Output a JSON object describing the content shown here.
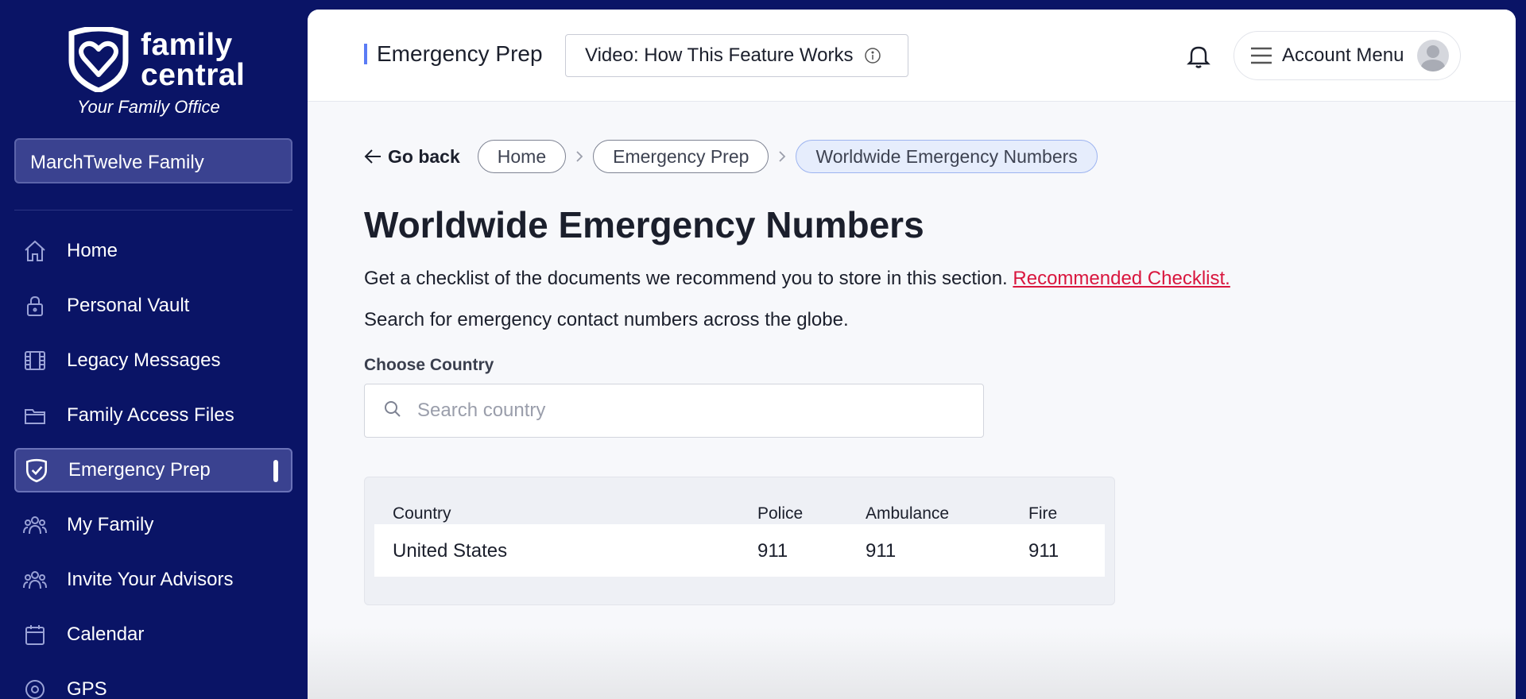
{
  "brand": {
    "name_line1": "family",
    "name_line2": "central",
    "tagline": "Your Family Office"
  },
  "family_selector": "MarchTwelve Family",
  "sidebar": {
    "items": [
      {
        "label": "Home",
        "icon": "home-icon"
      },
      {
        "label": "Personal Vault",
        "icon": "lock-icon"
      },
      {
        "label": "Legacy Messages",
        "icon": "film-icon"
      },
      {
        "label": "Family Access Files",
        "icon": "folder-icon"
      },
      {
        "label": "Emergency Prep",
        "icon": "shield-check-icon",
        "active": true
      },
      {
        "label": "My Family",
        "icon": "people-icon"
      },
      {
        "label": "Invite Your Advisors",
        "icon": "people-icon"
      },
      {
        "label": "Calendar",
        "icon": "calendar-icon"
      },
      {
        "label": "GPS",
        "icon": "location-icon"
      }
    ]
  },
  "header": {
    "title": "Emergency Prep",
    "video_button": "Video: How This Feature Works",
    "account_menu": "Account Menu"
  },
  "breadcrumb": {
    "back": "Go back",
    "items": [
      "Home",
      "Emergency Prep",
      "Worldwide Emergency Numbers"
    ]
  },
  "page": {
    "title": "Worldwide Emergency Numbers",
    "checklist_text": "Get a checklist of the documents we recommend you to store in this section.",
    "checklist_link": "Recommended Checklist.",
    "search_text": "Search for emergency contact numbers across the globe.",
    "field_label": "Choose Country",
    "search_placeholder": "Search country"
  },
  "table": {
    "headers": [
      "Country",
      "Police",
      "Ambulance",
      "Fire"
    ],
    "rows": [
      [
        "United States",
        "911",
        "911",
        "911"
      ]
    ]
  },
  "colors": {
    "sidebar_bg": "#0a1466",
    "accent": "#5b7cf5",
    "link": "#d9163e"
  }
}
